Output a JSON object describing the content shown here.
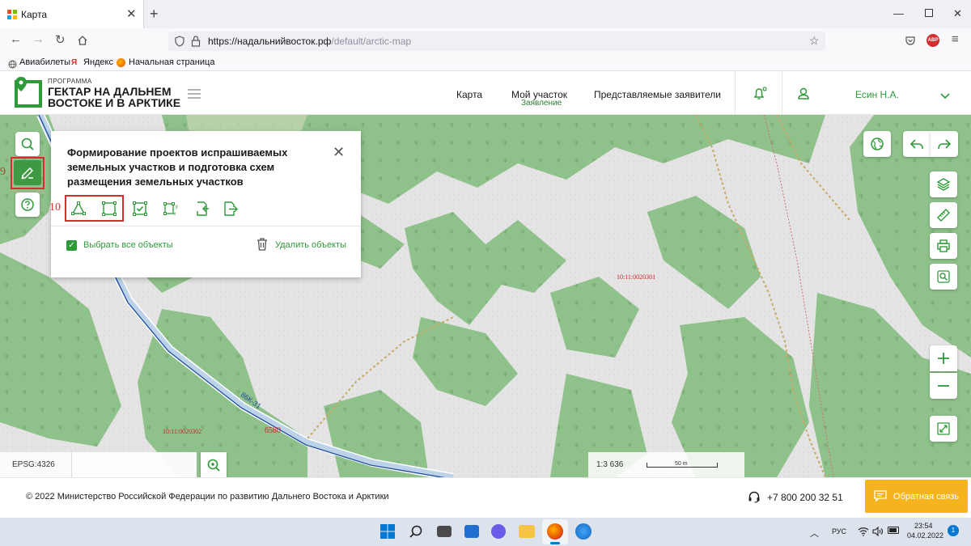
{
  "browser": {
    "tab_title": "Карта",
    "url_host": "https://надальнийвосток.рф",
    "url_path": "/default/arctic-map",
    "bookmarks": [
      "Авиабилеты",
      "Яндекс",
      "Начальная страница"
    ],
    "abp_badge": "ABP"
  },
  "site": {
    "logo_small": "ПРОГРАММА",
    "logo_line1": "ГЕКТАР НА ДАЛЬНЕМ",
    "logo_line2": "ВОСТОКЕ И В АРКТИКЕ",
    "menu": {
      "map": "Карта",
      "my_plot": "Мой участок",
      "my_plot_sub": "Заявление",
      "applicants": "Представляемые заявители"
    },
    "user_name": "Есин Н.А."
  },
  "panel": {
    "title": "Формирование проектов испрашиваемых земельных участков и подготовка схем размещения земельных участков",
    "select_all": "Выбрать все объекты",
    "delete": "Удалить объекты"
  },
  "annotations": {
    "n9": "9",
    "n10": "10"
  },
  "map": {
    "labels": {
      "cadastral1": "10:11:0020301",
      "cadastral2": "10:11:0020302",
      "road": "86К-31",
      "number": "6580"
    },
    "epsg": "EPSG:4326",
    "scale": "1:3 636",
    "scale_bar": "50 m"
  },
  "footer": {
    "copyright": "© 2022 Министерство Российской Федерации по развитию Дальнего Востока и Арктики",
    "phone": "+7 800 200 32 51",
    "feedback": "Обратная связь"
  },
  "taskbar": {
    "lang": "РУС",
    "time": "23:54",
    "date": "04.02.2022",
    "notif": "1"
  },
  "colors": {
    "accent": "#2e9a3a",
    "forest": "#8fc18a",
    "feedback": "#f5b41e",
    "annotation": "#d32f2f"
  }
}
